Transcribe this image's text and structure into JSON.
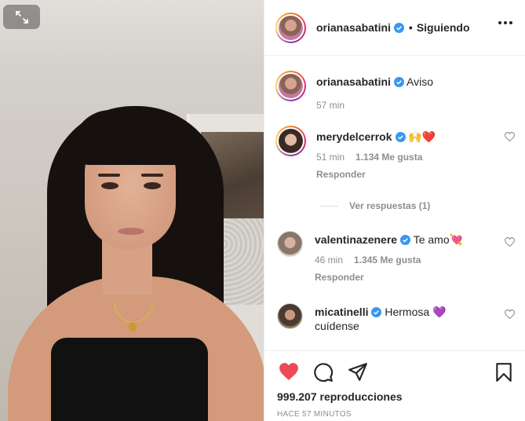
{
  "header": {
    "username": "orianasabatini",
    "separator": "•",
    "follow_status": "Siguiendo"
  },
  "caption": {
    "username": "orianasabatini",
    "text": "Aviso",
    "time": "57 min"
  },
  "comments": [
    {
      "username": "merydelcerrok",
      "text": "🙌❤️",
      "time": "51 min",
      "likes": "1.134 Me gusta",
      "reply": "Responder"
    },
    {
      "username": "valentinazenere",
      "text": "Te amo💘",
      "time": "46 min",
      "likes": "1.345 Me gusta",
      "reply": "Responder"
    },
    {
      "username": "micatinelli",
      "text": "Hermosa 💜",
      "text2": "cuídense"
    }
  ],
  "view_replies": "Ver respuestas (1)",
  "footer": {
    "views": "999.207 reproducciones",
    "posted": "HACE 57 MINUTOS"
  },
  "colors": {
    "verified": "#3897f0",
    "liked": "#ed4956",
    "muted": "#8e8e8e"
  },
  "icons": [
    "expand-icon",
    "verified-icon",
    "more-icon",
    "heart-icon",
    "comment-icon",
    "share-icon",
    "bookmark-icon"
  ]
}
